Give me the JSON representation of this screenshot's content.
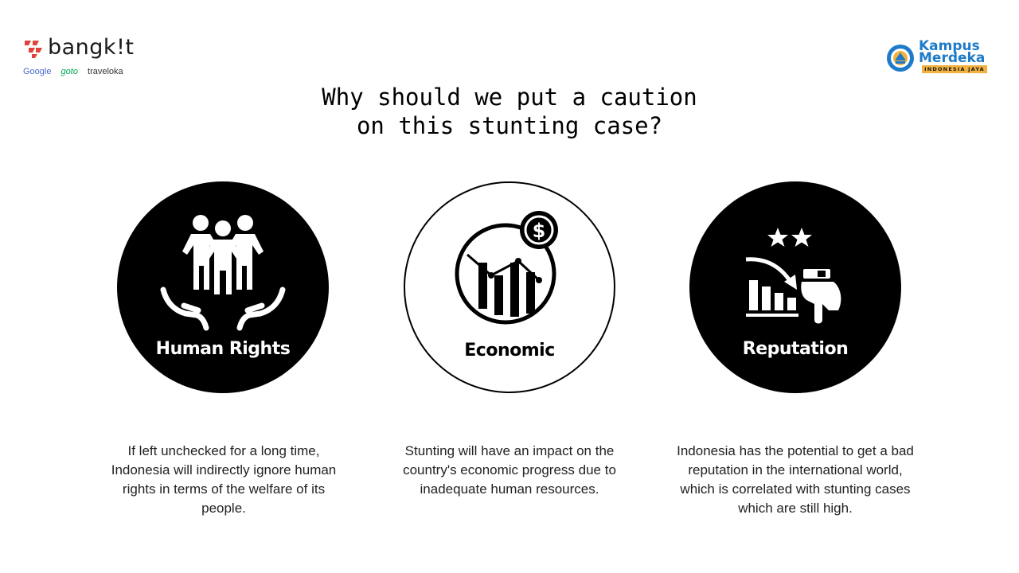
{
  "brand": {
    "name": "bangk!t",
    "partners": [
      "Google",
      "goto",
      "traveloka"
    ]
  },
  "logo_right": {
    "line1": "Kampus",
    "line2": "Merdeka",
    "banner": "INDONESIA JAYA"
  },
  "title": {
    "line1": "Why should we put a caution",
    "line2": "on this stunting case?"
  },
  "cards": [
    {
      "label": "Human Rights",
      "icon": "people-in-hands-icon",
      "style": "dark",
      "description": "If left unchecked for a long time, Indonesia will indirectly ignore human rights in terms of the welfare of its people."
    },
    {
      "label": "Economic",
      "icon": "economic-decline-chart-icon",
      "style": "light",
      "description": "Stunting will have an impact on the country's economic progress due to inadequate human resources."
    },
    {
      "label": "Reputation",
      "icon": "reputation-decline-icon",
      "style": "dark",
      "description": "Indonesia has the potential to get a bad reputation in the international world, which is correlated with stunting cases which are still high."
    }
  ],
  "colors": {
    "text": "#000000",
    "circle_dark": "#000000",
    "brand_red": "#e0433a",
    "km_blue": "#1e7bc9",
    "km_banner": "#f3b23f"
  }
}
